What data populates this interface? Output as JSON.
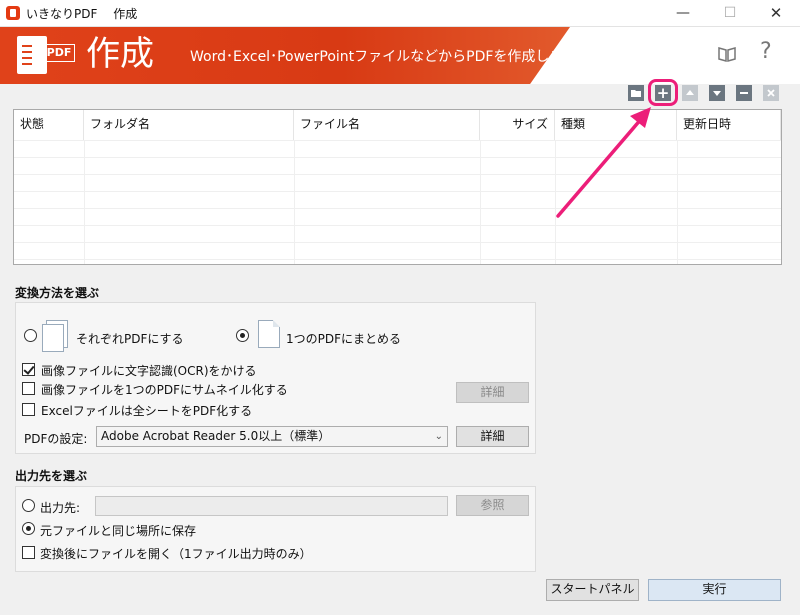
{
  "window": {
    "title": "いきなりPDF　 作成",
    "minimize": "—",
    "maximize": "☐",
    "close": "✕"
  },
  "banner": {
    "logo_tag": "PDF",
    "title": "作成",
    "subtitle": "Word･Excel･PowerPointファイルなどからPDFを作成します",
    "help": "?"
  },
  "toolbar": {
    "add_symbol": "+",
    "folder_icon": "folder-icon",
    "add_icon": "plus-icon",
    "up_icon": "up-arrow-icon",
    "down_icon": "down-arrow-icon",
    "remove_icon": "minus-icon",
    "clear_icon": "close-icon"
  },
  "table": {
    "columns": [
      {
        "label": "状態",
        "align": "left"
      },
      {
        "label": "フォルダ名",
        "align": "left"
      },
      {
        "label": "ファイル名",
        "align": "left"
      },
      {
        "label": "サイズ",
        "align": "right"
      },
      {
        "label": "種類",
        "align": "left"
      },
      {
        "label": "更新日時",
        "align": "left"
      }
    ],
    "rows": []
  },
  "convert": {
    "heading": "変換方法を選ぶ",
    "separate_label": "それぞれPDFにする",
    "separate_selected": false,
    "merge_label": "1つのPDFにまとめる",
    "merge_selected": true,
    "ocr_label": "画像ファイルに文字認識(OCR)をかける",
    "ocr_checked": true,
    "thumbnail_label": "画像ファイルを1つのPDFにサムネイル化する",
    "thumbnail_checked": false,
    "excel_label": "Excelファイルは全シートをPDF化する",
    "excel_checked": false,
    "detail_label": "詳細",
    "pdf_setting_label": "PDFの設定:",
    "pdf_setting_value": "Adobe Acrobat Reader 5.0以上（標準）",
    "pdf_detail_label": "詳細"
  },
  "output": {
    "heading": "出力先を選ぶ",
    "dest_label": "出力先:",
    "dest_selected": false,
    "dest_value": "",
    "browse_label": "参照",
    "same_place_label": "元ファイルと同じ場所に保存",
    "same_place_selected": true,
    "open_after_label": "変換後にファイルを開く（1ファイル出力時のみ）",
    "open_after_checked": false
  },
  "footer": {
    "start_panel_label": "スタートパネル",
    "execute_label": "実行"
  },
  "colors": {
    "accent": "#e0421a",
    "highlight": "#ec1e79"
  }
}
